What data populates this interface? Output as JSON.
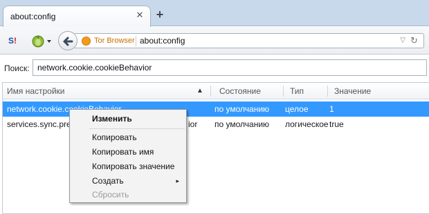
{
  "tab": {
    "title": "about:config",
    "close_icon": "close-icon",
    "new_tab_icon": "plus-icon"
  },
  "toolbar": {
    "ext1_s": "S",
    "ext1_one": "!",
    "site_name": "Tor Browser",
    "url": "about:config",
    "dropdown_icon": "chevron-down-icon",
    "reload_icon": "reload-icon"
  },
  "search": {
    "label": "Поиск:",
    "value": "network.cookie.cookieBehavior"
  },
  "table": {
    "columns": [
      "Имя настройки",
      "Состояние",
      "Тип",
      "Значение"
    ],
    "sort_icon": "sort-asc-icon",
    "rows": [
      {
        "name": "network.cookie.cookieBehavior",
        "state": "по умолчанию",
        "type": "целое",
        "value": "1",
        "selected": true
      },
      {
        "name": "services.sync.prefs",
        "name_tail": "ior",
        "state": "по умолчанию",
        "type": "логическое",
        "value": "true",
        "selected": false
      }
    ]
  },
  "context_menu": {
    "items": [
      {
        "label": "Изменить",
        "bold": true
      },
      {
        "label": "Копировать"
      },
      {
        "label": "Копировать имя"
      },
      {
        "label": "Копировать значение"
      },
      {
        "label": "Создать",
        "submenu": true
      },
      {
        "label": "Сбросить",
        "disabled": true
      }
    ],
    "submenu_arrow": "▸"
  },
  "colors": {
    "selection": "#3399ff",
    "accent_orange": "#f29b1a",
    "tabstrip": "#c9d9ec"
  }
}
